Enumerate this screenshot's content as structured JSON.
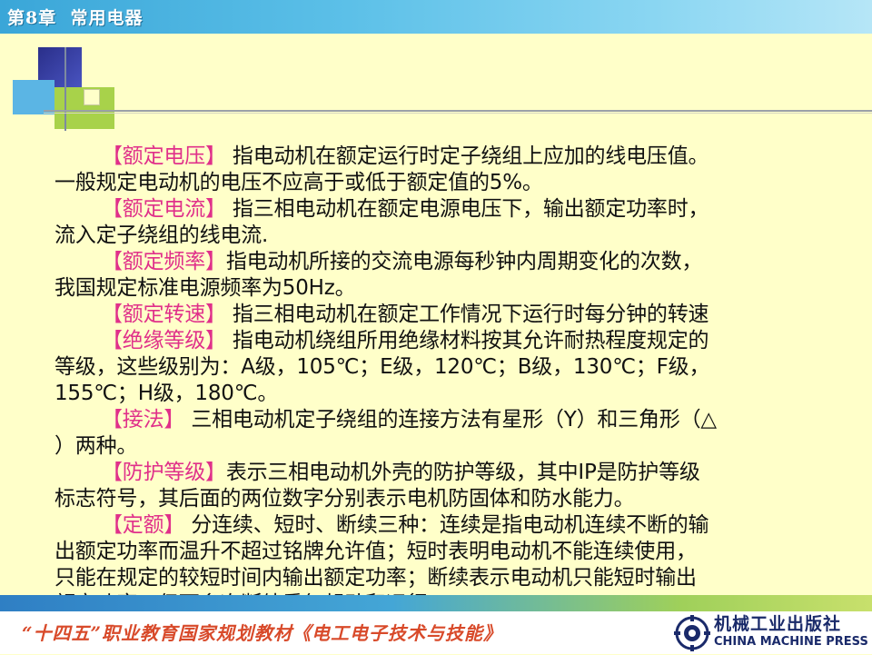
{
  "header": {
    "title": "第8章  常用电器"
  },
  "content": {
    "lines": [
      {
        "indent": true,
        "tag": "【额定电压】",
        "text": " 指电动机在额定运行时定子绕组上应加的线电压值。"
      },
      {
        "indent": false,
        "tag": "",
        "text": "一般规定电动机的电压不应高于或低于额定值的5%。"
      },
      {
        "indent": true,
        "tag": "【额定电流】",
        "text": " 指三相电动机在额定电源电压下，输出额定功率时，"
      },
      {
        "indent": false,
        "tag": "",
        "text": "流入定子绕组的线电流."
      },
      {
        "indent": true,
        "tag": "【额定频率】",
        "text": "指电动机所接的交流电源每秒钟内周期变化的次数，"
      },
      {
        "indent": false,
        "tag": "",
        "text": "我国规定标准电源频率为50Hz。"
      },
      {
        "indent": true,
        "tag": "【额定转速】",
        "text": " 指三相电动机在额定工作情况下运行时每分钟的转速"
      },
      {
        "indent": true,
        "tag": "【绝缘等级】",
        "text": " 指电动机绕组所用绝缘材料按其允许耐热程度规定的"
      },
      {
        "indent": false,
        "tag": "",
        "text": "等级，这些级别为：A级，105℃；E级，120℃；B级，130℃；F级，"
      },
      {
        "indent": false,
        "tag": "",
        "text": "155℃；H级，180℃。"
      },
      {
        "indent": true,
        "tag": "【接法】",
        "text": " 三相电动机定子绕组的连接方法有星形（Y）和三角形（△"
      },
      {
        "indent": false,
        "tag": "",
        "text": "）两种。"
      },
      {
        "indent": true,
        "tag": "【防护等级】",
        "text": "表示三相电动机外壳的防护等级，其中IP是防护等级"
      },
      {
        "indent": false,
        "tag": "",
        "text": "标志符号，其后面的两位数字分别表示电机防固体和防水能力。"
      },
      {
        "indent": true,
        "tag": "【定额】",
        "text": " 分连续、短时、断续三种：连续是指电动机连续不断的输"
      },
      {
        "indent": false,
        "tag": "",
        "text": "出额定功率而温升不超过铭牌允许值；短时表明电动机不能连续使用，"
      },
      {
        "indent": false,
        "tag": "",
        "text": "只能在规定的较短时间内输出额定功率；断续表示电动机只能短时输出"
      },
      {
        "indent": false,
        "tag": "",
        "text": "额定功率，但可多次断续重复起动和运行。"
      }
    ]
  },
  "footer": {
    "series": "“十四五”职业教育国家规划教材《电工电子技术与技能》",
    "publisher_cn": "机械工业出版社",
    "publisher_en": "CHINA MACHINE PRESS"
  },
  "colors": {
    "tag": "#e0308a",
    "background": "#ffffc9",
    "header": "#3aa6d8"
  }
}
